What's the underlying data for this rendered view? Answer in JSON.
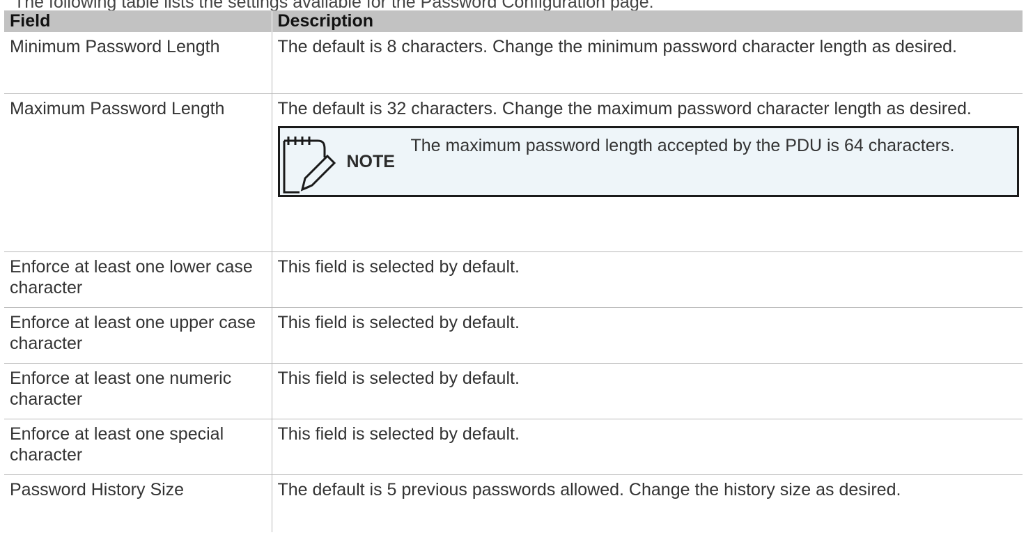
{
  "intro_text": "The following table lists the settings available for the Password Configuration page:",
  "table": {
    "headers": [
      "Field",
      "Description"
    ],
    "rows": [
      {
        "field": "Minimum Password Length",
        "description": "The default is 8 characters. Change the minimum password character length as desired."
      },
      {
        "field": "Maximum Password Length",
        "description": "The default is 32 characters. Change the maximum password character length as desired."
      },
      {
        "field": "Enforce at least one lower case character",
        "description": "This field is selected by default."
      },
      {
        "field": "Enforce at least one upper case character",
        "description": "This field is selected by default."
      },
      {
        "field": "Enforce at least one numeric character",
        "description": "This field is selected by default."
      },
      {
        "field": "Enforce at least one special character",
        "description": "This field is selected by default."
      },
      {
        "field": "Password History Size",
        "description": "The default is 5 previous passwords allowed. Change the history size as desired."
      }
    ]
  },
  "note": {
    "label": "NOTE",
    "text": "The maximum password length accepted by the PDU is 64 characters.",
    "icon": "notepad-pencil-icon"
  }
}
